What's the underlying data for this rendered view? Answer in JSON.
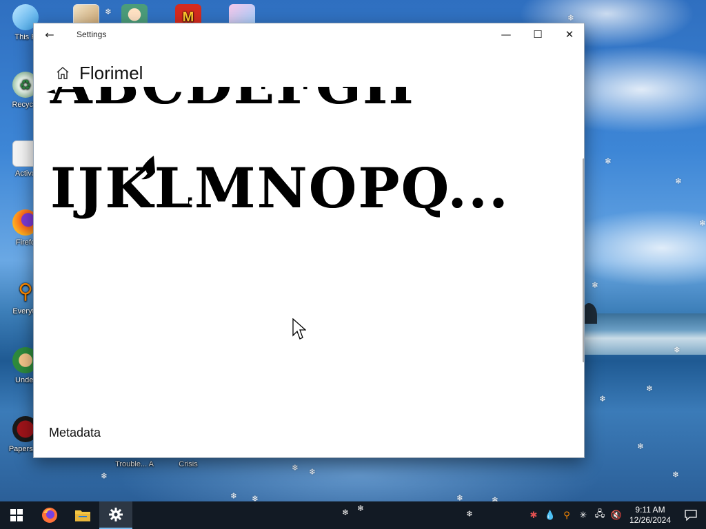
{
  "desktop": {
    "icons": [
      {
        "label": "This P",
        "icon": "this-pc-icon"
      },
      {
        "label": "Recycle",
        "icon": "recycle-bin-icon"
      },
      {
        "label": "Activa",
        "icon": "activate-windows-icon"
      },
      {
        "label": "Firefo",
        "icon": "firefox-icon"
      },
      {
        "label": "Everyth",
        "icon": "everything-search-icon"
      },
      {
        "label": "Under",
        "icon": "undertale-icon"
      },
      {
        "label": "Papers, P",
        "icon": "papers-please-icon"
      }
    ],
    "bottom_icons": [
      {
        "label": "Trouble... A",
        "icon": "trouble-app-icon"
      },
      {
        "label": "Crisis",
        "icon": "crisis-app-icon"
      }
    ],
    "top_icons": [
      "paint-app-icon",
      "anime-game-icon",
      "mcdonalds-icon",
      "unicorn-game-icon"
    ]
  },
  "window": {
    "title": "Settings",
    "back_symbol": "←",
    "minimize_symbol": "—",
    "maximize_symbol": "☐",
    "close_symbol": "✕",
    "page_title": "Florimel",
    "sample_lines": [
      "ABCDEFGH",
      "IJKLMNOPQ...",
      ""
    ],
    "sample_line_1": "ABCDEFGH",
    "sample_line_2": "IJKLMNOPQ...",
    "metadata_label": "Metadata"
  },
  "taskbar": {
    "pinned": [
      "windows-start-icon",
      "firefox-icon",
      "file-explorer-icon",
      "settings-gear-icon"
    ],
    "tray_icons": [
      "people-icon",
      "water-drop-icon",
      "search-tray-icon",
      "snowflake-icon",
      "network-icon",
      "volume-muted-icon"
    ],
    "time": "9:11 AM",
    "date": "12/26/2024"
  },
  "colors": {
    "taskbar": "#121a24",
    "taskbar_active": "#2d3744",
    "accent": "#76b9ed"
  }
}
